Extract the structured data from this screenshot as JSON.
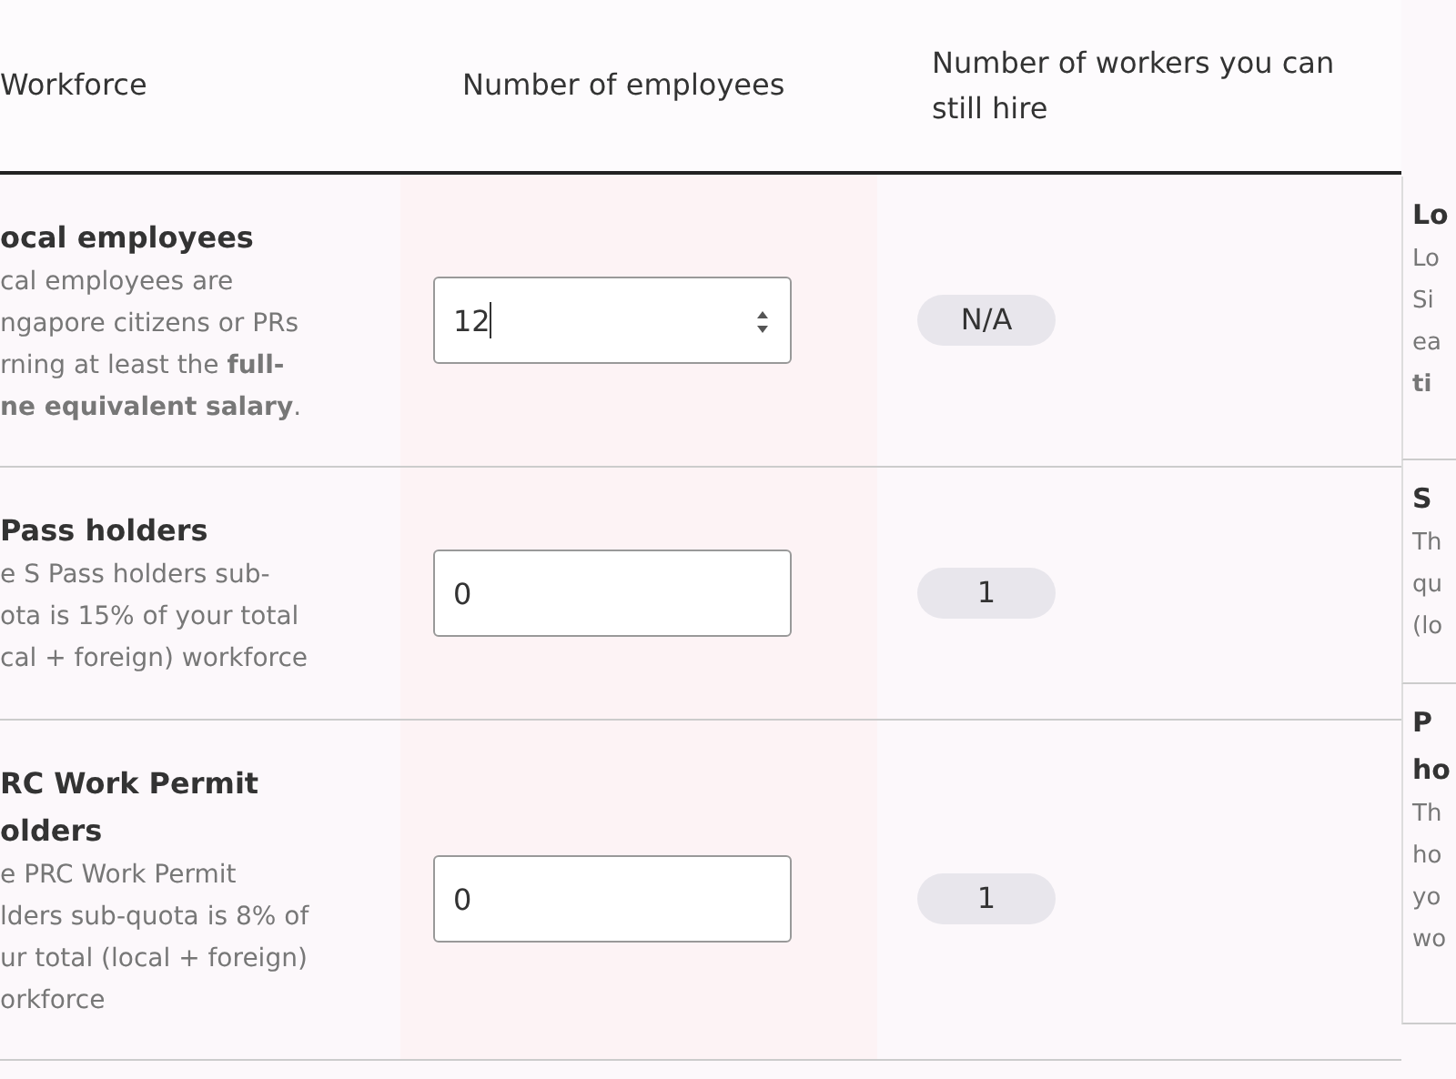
{
  "table": {
    "columns": [
      "Workforce",
      "Number of employees",
      "Number of workers you can still hire"
    ],
    "rows": [
      {
        "title": [
          "ocal employees"
        ],
        "description": [
          "cal employees are",
          "ngapore citizens or PRs",
          "rning at least the **full-**",
          "**ne equivalent salary**."
        ],
        "value": "12",
        "spinner": true,
        "remaining": "N/A"
      },
      {
        "title": [
          "Pass holders"
        ],
        "description": [
          "e S Pass holders sub-",
          "ota is 15% of your total",
          "cal + foreign) workforce"
        ],
        "value": "0",
        "spinner": false,
        "remaining": "1"
      },
      {
        "title": [
          "RC Work Permit",
          "olders"
        ],
        "description": [
          "e PRC Work Permit",
          "lders sub-quota is 8% of",
          "ur total (local + foreign)",
          "orkforce"
        ],
        "value": "0",
        "spinner": false,
        "remaining": "1"
      }
    ]
  },
  "side_panel": {
    "items": [
      {
        "title": [
          "Lo"
        ],
        "description": [
          "Lo",
          "Si",
          "ea",
          "**ti**"
        ]
      },
      {
        "title": [
          "S"
        ],
        "description": [
          "Th",
          "qu",
          "(lo"
        ]
      },
      {
        "title": [
          "P",
          "ho"
        ],
        "description": [
          "Th",
          "ho",
          "yo",
          "wo"
        ]
      }
    ]
  }
}
